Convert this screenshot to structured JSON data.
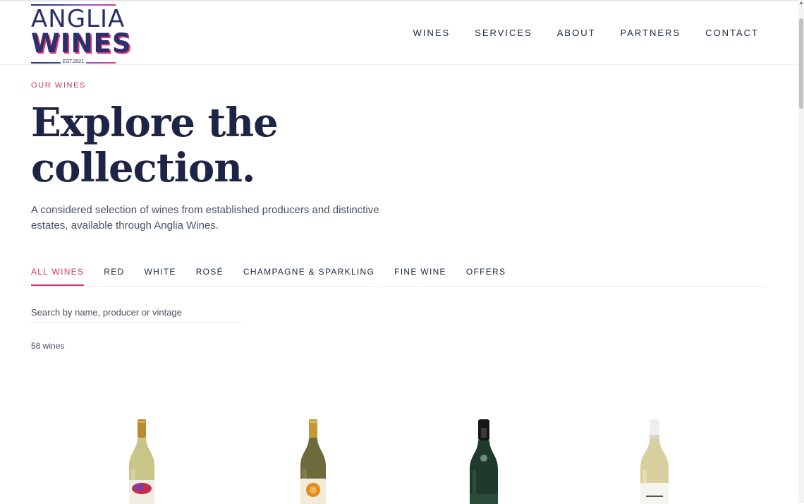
{
  "header": {
    "logo": {
      "line1": "ANGLIA",
      "line2": "WINES",
      "est": "EST.2021"
    },
    "nav": [
      "WINES",
      "SERVICES",
      "ABOUT",
      "PARTNERS",
      "CONTACT"
    ]
  },
  "hero": {
    "eyebrow": "OUR WINES",
    "title_line1": "Explore the",
    "title_line2": "collection.",
    "intro": "A considered selection of wines from established producers and distinctive estates, available through Anglia Wines."
  },
  "filters": {
    "tabs": [
      "ALL WINES",
      "RED",
      "WHITE",
      "ROSÉ",
      "CHAMPAGNE & SPARKLING",
      "FINE WINE",
      "OFFERS"
    ],
    "active_tab": "ALL WINES"
  },
  "search": {
    "placeholder": "Search by name, producer or vintage",
    "value": ""
  },
  "results": {
    "count_label": "58 wines"
  },
  "products": [
    {
      "image": "white-wine-bottle-gold-capsule-red-label"
    },
    {
      "image": "white-wine-bottle-gold-capsule-orange-label"
    },
    {
      "image": "champagne-bottle-dark-green"
    },
    {
      "image": "white-wine-bottle-white-capsule"
    }
  ],
  "colors": {
    "accent": "#d6336c",
    "text": "#1e2445",
    "muted": "#4a4f63",
    "divider": "#eceef2"
  }
}
